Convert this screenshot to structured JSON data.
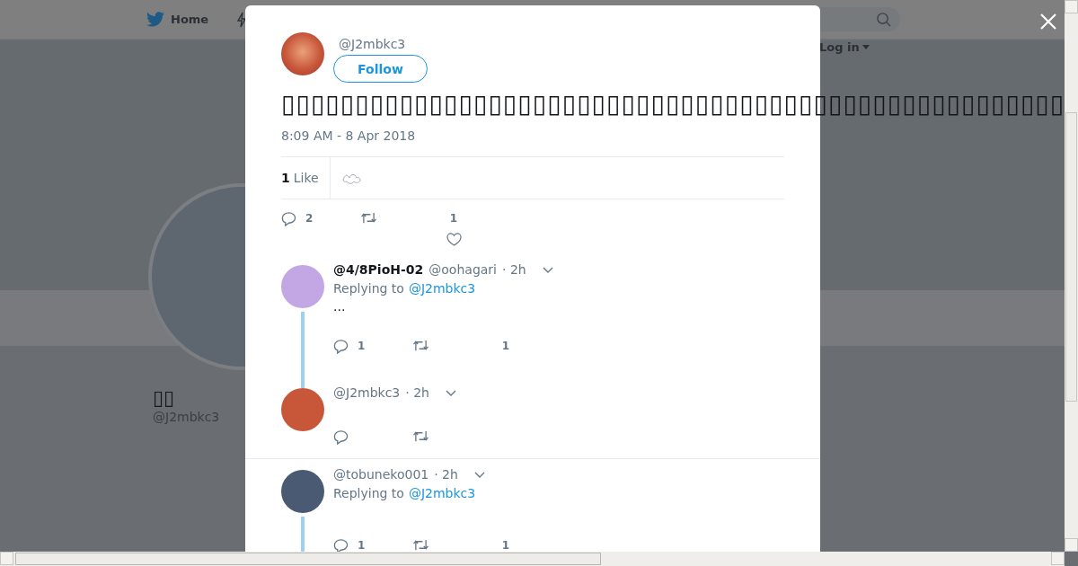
{
  "nav": {
    "home_label": "Home",
    "login_label": "Log in"
  },
  "profile": {
    "name": "▯▯",
    "handle": "@J2mbkc3"
  },
  "tweet": {
    "handle": "@J2mbkc3",
    "follow_label": "Follow",
    "text": "▯▯▯▯▯▯▯▯▯▯▯▯▯▯▯▯▯▯▯▯▯▯▯▯▯▯▯▯▯▯▯▯▯▯▯▯▯▯▯▯▯▯▯▯▯▯▯▯▯▯▯▯▯",
    "timestamp": "8:09 AM - 8 Apr 2018",
    "likes_count": "1",
    "likes_label": "Like",
    "reply_count": "2",
    "like_count": "1"
  },
  "replies": [
    {
      "display_name": "@4/8PioH-02",
      "handle": "@oohagari",
      "time": "· 2h",
      "replying_to": "Replying to",
      "reply_target": "@J2mbkc3",
      "text": "...",
      "reply_count": "1",
      "like_count": "1",
      "threaded": true,
      "color": "#c3a6e4"
    },
    {
      "handle": "@J2mbkc3",
      "time": "· 2h",
      "threaded": false,
      "color": "#c8573a"
    },
    {
      "handle": "@tobuneko001",
      "time": "· 2h",
      "replying_to": "Replying to",
      "reply_target": "@J2mbkc3",
      "reply_count": "1",
      "like_count": "1",
      "threaded": true,
      "color": "#4a5a72"
    }
  ]
}
